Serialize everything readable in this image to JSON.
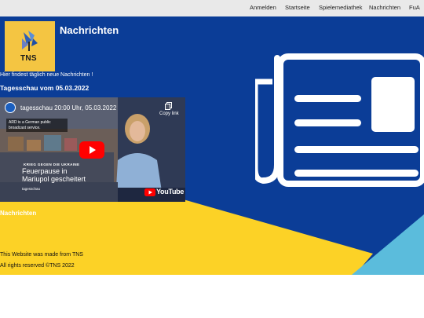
{
  "nav": {
    "items": [
      "Anmelden",
      "Startseite",
      "Spielemediathek",
      "Nachrichten",
      "FuA"
    ]
  },
  "logo": {
    "text": "TNS"
  },
  "header": {
    "title": "Nachrichten"
  },
  "main": {
    "intro": "Hier findest täglich neue Nachrichten !",
    "video_heading": "Tagesschau vom 05.03.2022",
    "video": {
      "title": "tagesschau 20:00 Uhr, 05.03.2022",
      "copy_label": "Copy link",
      "info": "ARD is a German public broadcast service.",
      "kicker": "KRIEG GEGEN DIE UKRAINE",
      "headline_1": "Feuerpause in",
      "headline_2": "Mariupol gescheitert",
      "brand": "tagesschau",
      "platform": "YouTube"
    },
    "section_label": "Nachrichten"
  },
  "footer": {
    "made_by": "This Website was made from TNS",
    "rights": "All rights reserved ©TNS 2022"
  },
  "colors": {
    "nav_bg": "#e9e9e9",
    "blue": "#0b3d97",
    "yellow": "#fcd226",
    "light_blue": "#5bbcdc",
    "logo_bg": "#f4c542",
    "youtube_red": "#ff0000"
  },
  "icons": [
    "newspaper-icon",
    "copy-icon",
    "play-icon",
    "youtube-icon",
    "tns-logo"
  ]
}
